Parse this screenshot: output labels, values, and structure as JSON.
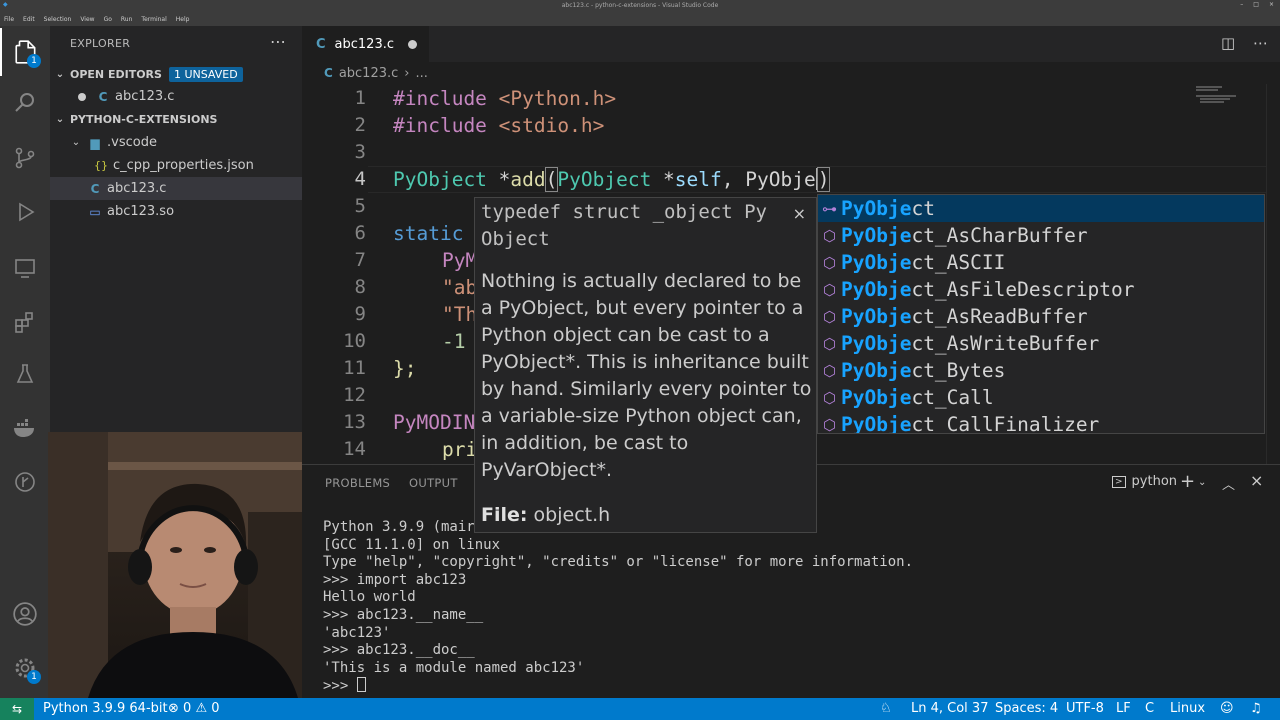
{
  "window": {
    "title": "abc123.c - python-c-extensions - Visual Studio Code",
    "menu": [
      "File",
      "Edit",
      "Selection",
      "View",
      "Go",
      "Run",
      "Terminal",
      "Help"
    ]
  },
  "activity_bar": {
    "explorer_badge": "1",
    "settings_badge": "1"
  },
  "sidebar": {
    "header": "EXPLORER",
    "open_editors": {
      "label": "OPEN EDITORS",
      "unsaved_badge": "1 UNSAVED",
      "files": [
        "abc123.c"
      ]
    },
    "project": {
      "label": "PYTHON-C-EXTENSIONS",
      "folder": ".vscode",
      "folder_files": [
        "c_cpp_properties.json"
      ],
      "files": [
        "abc123.c",
        "abc123.so"
      ]
    }
  },
  "editor": {
    "tab_label": "abc123.c",
    "breadcrumb": [
      "abc123.c",
      "..."
    ],
    "line_numbers": [
      "1",
      "2",
      "3",
      "4",
      "5",
      "6",
      "7",
      "8",
      "9",
      "10",
      "11",
      "12",
      "13",
      "14"
    ],
    "current_line": 4,
    "code": {
      "l1_a": "#include",
      "l1_b": " <Python.h>",
      "l2_a": "#include",
      "l2_b": " <stdio.h>",
      "l4_type": "PyObject",
      "l4_star": " *",
      "l4_fn": "add",
      "l4_paren": "(",
      "l4_type2": "PyObject",
      "l4_star2": " *",
      "l4_self": "self",
      "l4_comma": ", ",
      "l4_partial": "PyObje",
      "l4_close": ")",
      "l6_kw": "static",
      "l7_a": "PyM",
      "l8_a": "\"ab",
      "l9_a": "\"Th",
      "l10_a": "-1",
      "l11_a": "};",
      "l13_a": "PyMODIN",
      "l14_a": "pri"
    }
  },
  "hover": {
    "signature": "typedef struct _object Py\nObject",
    "close": "×",
    "description": "Nothing is actually declared to be a PyObject, but every pointer to a Python object can be cast to a PyObject*. This is inheritance built by hand. Similarly every pointer to a variable-size Python object can, in addition, be cast to PyVarObject*.",
    "file_label": "File:",
    "file_value": " object.h"
  },
  "suggestions": {
    "match": "PyObje",
    "items": [
      {
        "rest": "ct",
        "icon": "⊶"
      },
      {
        "rest": "ct_AsCharBuffer",
        "icon": "⬡"
      },
      {
        "rest": "ct_ASCII",
        "icon": "⬡"
      },
      {
        "rest": "ct_AsFileDescriptor",
        "icon": "⬡"
      },
      {
        "rest": "ct_AsReadBuffer",
        "icon": "⬡"
      },
      {
        "rest": "ct_AsWriteBuffer",
        "icon": "⬡"
      },
      {
        "rest": "ct_Bytes",
        "icon": "⬡"
      },
      {
        "rest": "ct_Call",
        "icon": "⬡"
      },
      {
        "rest": "ct_CallFinalizer",
        "icon": "⬡"
      }
    ]
  },
  "panel": {
    "tabs": [
      "PROBLEMS",
      "OUTPUT"
    ],
    "terminal_name": "python",
    "terminal_lines": [
      "Python 3.9.9 (mair",
      "[GCC 11.1.0] on linux",
      "Type \"help\", \"copyright\", \"credits\" or \"license\" for more information.",
      ">>> import abc123",
      "Hello world",
      ">>> abc123.__name__",
      "'abc123'",
      ">>> abc123.__doc__",
      "'This is a module named abc123'"
    ],
    "prompt": ">>> "
  },
  "status_bar": {
    "interpreter": "Python 3.9.9 64-bit",
    "errors": "0",
    "warnings": "0",
    "position": "Ln 4, Col 37",
    "spaces": "Spaces: 4",
    "encoding": "UTF-8",
    "eol": "LF",
    "language": "C",
    "os": "Linux"
  }
}
